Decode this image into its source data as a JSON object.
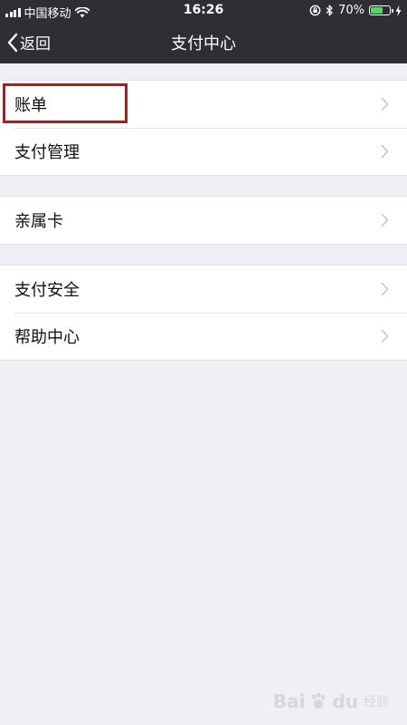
{
  "status_bar": {
    "carrier": "中国移动",
    "time": "16:26",
    "battery_percent": "70%",
    "battery_level": 0.7,
    "battery_color": "#4cd964",
    "icons": [
      "signal-icon",
      "wifi-icon",
      "orientation-lock-icon",
      "bluetooth-icon",
      "battery-icon",
      "charging-icon"
    ]
  },
  "nav": {
    "back_label": "返回",
    "title": "支付中心",
    "bg_color": "#2f2f33"
  },
  "groups": [
    {
      "items": [
        {
          "label": "账单",
          "highlighted": true
        },
        {
          "label": "支付管理"
        }
      ]
    },
    {
      "items": [
        {
          "label": "亲属卡"
        }
      ]
    },
    {
      "items": [
        {
          "label": "支付安全"
        },
        {
          "label": "帮助中心"
        }
      ]
    }
  ],
  "highlight_color": "#a0221c",
  "watermark": {
    "text": "Bai",
    "suffix": "du",
    "sub": "经验"
  }
}
